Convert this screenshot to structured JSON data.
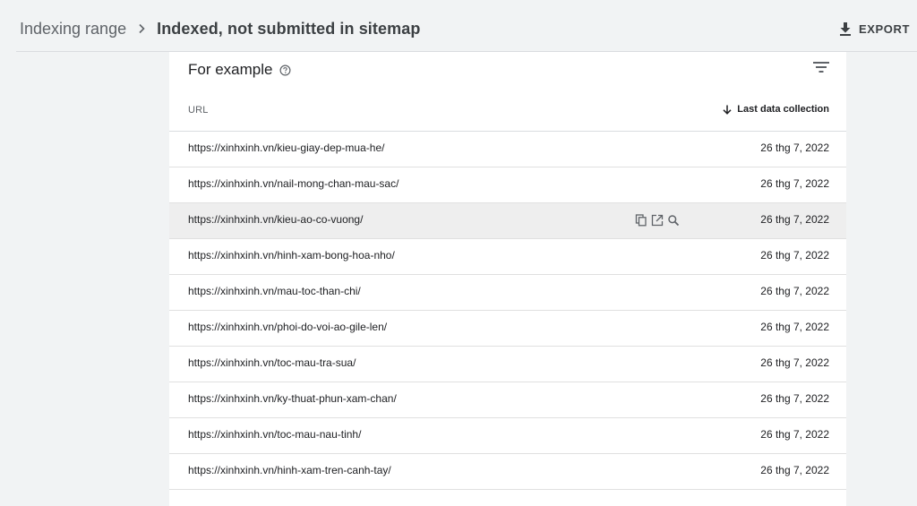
{
  "header": {
    "breadcrumb_parent": "Indexing range",
    "breadcrumb_current": "Indexed, not submitted in sitemap",
    "export_label": "EXPORT",
    "export_icon": "download-icon",
    "separator_icon": "chevron-right-icon"
  },
  "card": {
    "title": "For example",
    "help_icon": "help-circle-icon",
    "filter_icon": "filter-icon"
  },
  "table": {
    "columns": {
      "url": "URL",
      "date": "Last data collection",
      "sort_icon": "arrow-down-icon"
    },
    "rows": [
      {
        "url": "https://xinhxinh.vn/kieu-giay-dep-mua-he/",
        "date": "26 thg 7, 2022"
      },
      {
        "url": "https://xinhxinh.vn/nail-mong-chan-mau-sac/",
        "date": "26 thg 7, 2022"
      },
      {
        "url": "https://xinhxinh.vn/kieu-ao-co-vuong/",
        "date": "26 thg 7, 2022"
      },
      {
        "url": "https://xinhxinh.vn/hinh-xam-bong-hoa-nho/",
        "date": "26 thg 7, 2022"
      },
      {
        "url": "https://xinhxinh.vn/mau-toc-than-chi/",
        "date": "26 thg 7, 2022"
      },
      {
        "url": "https://xinhxinh.vn/phoi-do-voi-ao-gile-len/",
        "date": "26 thg 7, 2022"
      },
      {
        "url": "https://xinhxinh.vn/toc-mau-tra-sua/",
        "date": "26 thg 7, 2022"
      },
      {
        "url": "https://xinhxinh.vn/ky-thuat-phun-xam-chan/",
        "date": "26 thg 7, 2022"
      },
      {
        "url": "https://xinhxinh.vn/toc-mau-nau-tinh/",
        "date": "26 thg 7, 2022"
      },
      {
        "url": "https://xinhxinh.vn/hinh-xam-tren-canh-tay/",
        "date": "26 thg 7, 2022"
      }
    ],
    "hover_row_actions": [
      "copy-icon",
      "open-in-new-icon",
      "search-icon"
    ]
  },
  "colors": {
    "page_background": "#f1f3f4",
    "card_background": "#ffffff",
    "hover_row": "#eeeeee",
    "divider": "#dadce0"
  }
}
